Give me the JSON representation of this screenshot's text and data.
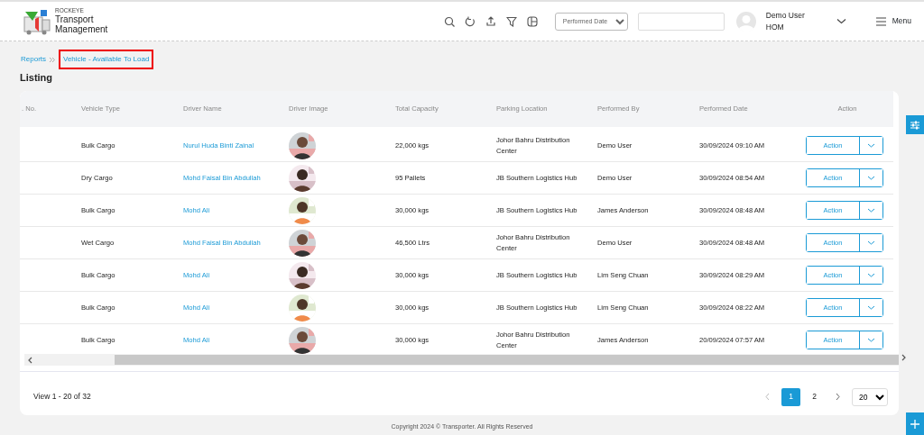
{
  "header": {
    "brand_small": "ROCKEYE",
    "brand_title": "Transport Management",
    "date_filter": {
      "value": "Performed Date"
    },
    "user": {
      "name": "Demo User",
      "role": "HOM"
    },
    "menu": "Menu"
  },
  "breadcrumb": [
    {
      "label": "Reports",
      "highlighted": false
    },
    {
      "label": "Vehicle - Available To Load",
      "highlighted": true
    }
  ],
  "page_title": "Listing",
  "table": {
    "columns": [
      ". No.",
      "Vehicle Type",
      "Driver Name",
      "Driver Image",
      "Total Capacity",
      "Parking Location",
      "Performed By",
      "Performed Date",
      "Action"
    ],
    "rows": [
      {
        "vehicle_type": "Bulk Cargo",
        "driver_name": "Nurul Huda Binti Zainal",
        "total_capacity": "22,000 kgs",
        "parking_location": "Johor Bahru Distribution Center",
        "performed_by": "Demo User",
        "performed_date": "30/09/2024 09:10 AM",
        "action": "Action"
      },
      {
        "vehicle_type": "Dry Cargo",
        "driver_name": "Mohd Faisal Bin Abdullah",
        "total_capacity": "95 Pallets",
        "parking_location": "JB Southern Logistics Hub",
        "performed_by": "Demo User",
        "performed_date": "30/09/2024 08:54 AM",
        "action": "Action"
      },
      {
        "vehicle_type": "Bulk Cargo",
        "driver_name": "Mohd Ali",
        "total_capacity": "30,000 kgs",
        "parking_location": "JB Southern Logistics Hub",
        "performed_by": "James Anderson",
        "performed_date": "30/09/2024 08:48 AM",
        "action": "Action"
      },
      {
        "vehicle_type": "Wet Cargo",
        "driver_name": "Mohd Faisal Bin Abdullah",
        "total_capacity": "46,500 Ltrs",
        "parking_location": "Johor Bahru Distribution Center",
        "performed_by": "Demo User",
        "performed_date": "30/09/2024 08:48 AM",
        "action": "Action"
      },
      {
        "vehicle_type": "Bulk Cargo",
        "driver_name": "Mohd Ali",
        "total_capacity": "30,000 kgs",
        "parking_location": "JB Southern Logistics Hub",
        "performed_by": "Lim Seng Chuan",
        "performed_date": "30/09/2024 08:29 AM",
        "action": "Action"
      },
      {
        "vehicle_type": "Bulk Cargo",
        "driver_name": "Mohd Ali",
        "total_capacity": "30,000 kgs",
        "parking_location": "JB Southern Logistics Hub",
        "performed_by": "Lim Seng Chuan",
        "performed_date": "30/09/2024 08:22 AM",
        "action": "Action"
      },
      {
        "vehicle_type": "Bulk Cargo",
        "driver_name": "Mohd Ali",
        "total_capacity": "30,000 kgs",
        "parking_location": "Johor Bahru Distribution Center",
        "performed_by": "James Anderson",
        "performed_date": "20/09/2024 07:57 AM",
        "action": "Action"
      }
    ]
  },
  "pagination": {
    "summary": "View 1 - 20 of 32",
    "pages": [
      {
        "label": "1",
        "selected": true
      },
      {
        "label": "2",
        "selected": false
      }
    ],
    "page_size": "20"
  },
  "footer": "Copyright 2024 © Transporter. All Rights Reserved"
}
